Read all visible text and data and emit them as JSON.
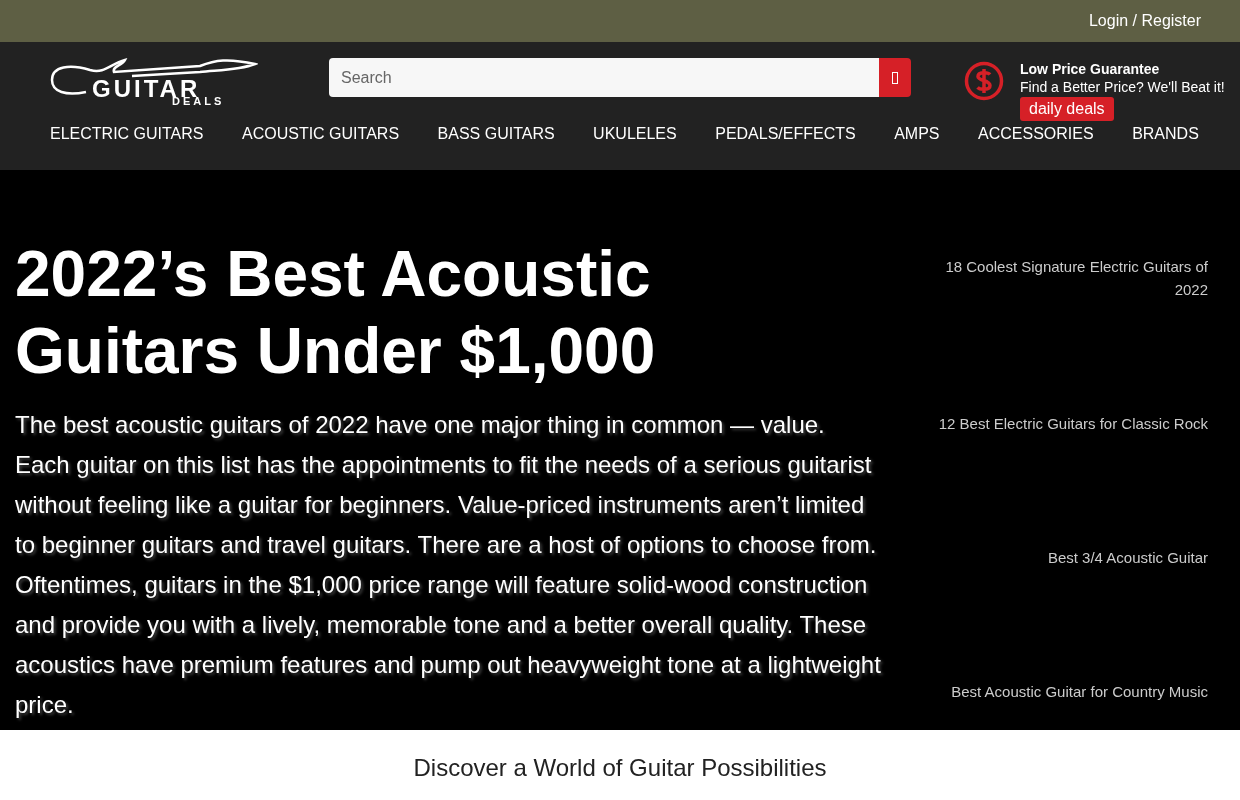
{
  "top_bar": {
    "login": "Login / Register"
  },
  "logo": {
    "name": "GUITAR",
    "tagline": "DEALS"
  },
  "search": {
    "placeholder": "Search"
  },
  "guarantee": {
    "title": "Low Price Guarantee",
    "subtitle": "Find a Better Price? We'll Beat it!",
    "badge": "daily deals"
  },
  "nav": [
    "ELECTRIC GUITARS",
    "ACOUSTIC GUITARS",
    "BASS GUITARS",
    "UKULELES",
    "PEDALS/EFFECTS",
    "AMPS",
    "ACCESSORIES",
    "BRANDS"
  ],
  "article": {
    "title": "2022’s Best Acoustic Guitars Under $1,000",
    "intro": "The best acoustic guitars of 2022 have one major thing in common — value. Each guitar on this list has the appointments to fit the needs of a serious guitarist without feeling like a guitar for beginners. Value-priced instruments aren’t limited to beginner guitars and travel guitars. There are a host of options to choose from. Oftentimes, guitars in the $1,000 price range will feature solid-wood construction and provide you with a lively, memorable tone and a better overall quality. These acoustics have premium features and pump out heavyweight tone at a lightweight price."
  },
  "related": [
    "18 Coolest Signature Electric Guitars of 2022",
    "12 Best Electric Guitars for Classic Rock",
    "Best 3/4 Acoustic Guitar",
    "Best Acoustic Guitar for Country Music"
  ],
  "footer_banner": "Discover a World of Guitar Possibilities"
}
